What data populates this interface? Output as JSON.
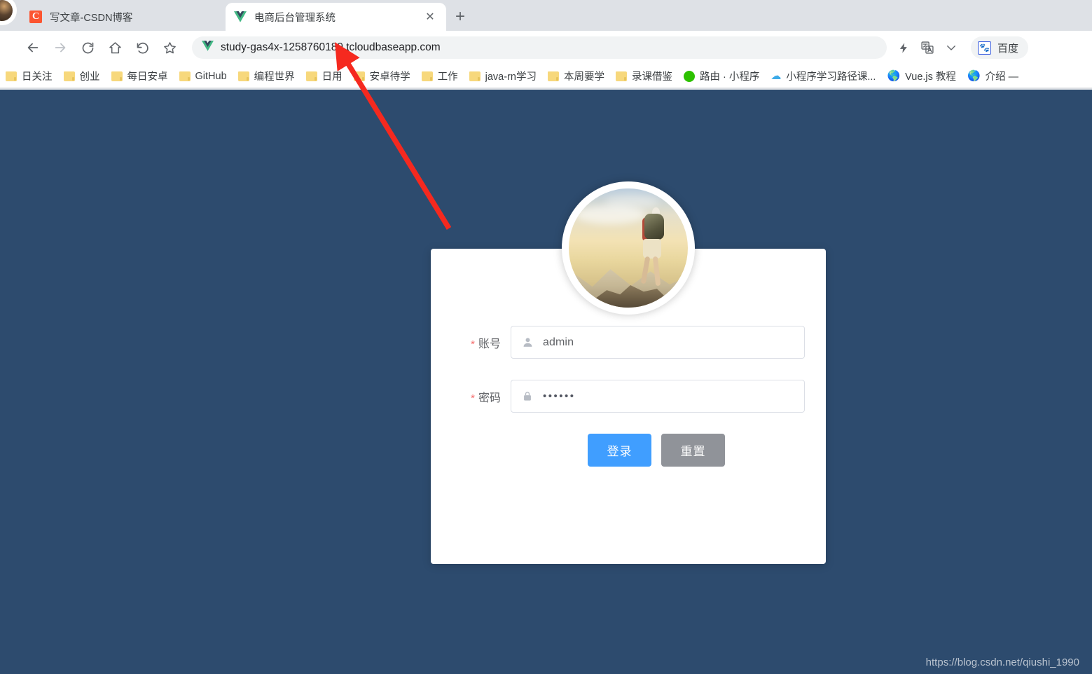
{
  "browser": {
    "tabs": [
      {
        "title": "写文章-CSDN博客",
        "favicon": "csdn-icon",
        "active": false
      },
      {
        "title": "电商后台管理系统",
        "favicon": "vue-icon",
        "active": true
      }
    ],
    "new_tab_label": "+",
    "close_label": "✕",
    "nav": {
      "back": "back-arrow-icon",
      "forward": "forward-arrow-icon",
      "reload": "reload-icon",
      "home": "home-icon",
      "history_back": "undo-icon",
      "bookmark": "star-icon"
    },
    "omnibox": {
      "url": "study-gas4x-1258760189.tcloudbaseapp.com",
      "site_icon": "vue-icon"
    },
    "toolbar_right": {
      "flash_icon": "lightning-bolt-icon",
      "translate_icon": "translate-icon",
      "chevron_icon": "chevron-down-icon",
      "extension_label": "百度",
      "extension_icon": "baidu-paw-icon"
    },
    "bookmarks": [
      {
        "label": "日关注",
        "icon": "folder-icon"
      },
      {
        "label": "创业",
        "icon": "folder-icon"
      },
      {
        "label": "每日安卓",
        "icon": "folder-icon"
      },
      {
        "label": "GitHub",
        "icon": "folder-icon"
      },
      {
        "label": "编程世界",
        "icon": "folder-icon"
      },
      {
        "label": "日用",
        "icon": "folder-icon"
      },
      {
        "label": "安卓待学",
        "icon": "folder-icon"
      },
      {
        "label": "工作",
        "icon": "folder-icon"
      },
      {
        "label": "java-rn学习",
        "icon": "folder-icon"
      },
      {
        "label": "本周要学",
        "icon": "folder-icon"
      },
      {
        "label": "录课借鉴",
        "icon": "folder-icon"
      },
      {
        "label": "路由 · 小程序",
        "icon": "wechat-icon"
      },
      {
        "label": "小程序学习路径课...",
        "icon": "cloud-icon"
      },
      {
        "label": "Vue.js 教程",
        "icon": "globe-icon"
      },
      {
        "label": "介绍 —",
        "icon": "globe-icon"
      }
    ]
  },
  "page": {
    "background_color": "#2d4b6e",
    "avatar": {
      "icon": "hiker-mountain-photo",
      "alt": "hiker on mountain summit"
    },
    "form": {
      "username": {
        "label": "账号",
        "required_mark": "*",
        "value": "admin",
        "icon": "user-icon"
      },
      "password": {
        "label": "密码",
        "required_mark": "*",
        "value": "••••••",
        "icon": "lock-icon"
      },
      "submit_label": "登录",
      "reset_label": "重置",
      "submit_color": "#409eff",
      "reset_color": "#909399"
    },
    "watermark": "https://blog.csdn.net/qiushi_1990",
    "annotation": {
      "type": "red-arrow",
      "color": "#f5291f",
      "points_at": "omnibox-url"
    }
  }
}
